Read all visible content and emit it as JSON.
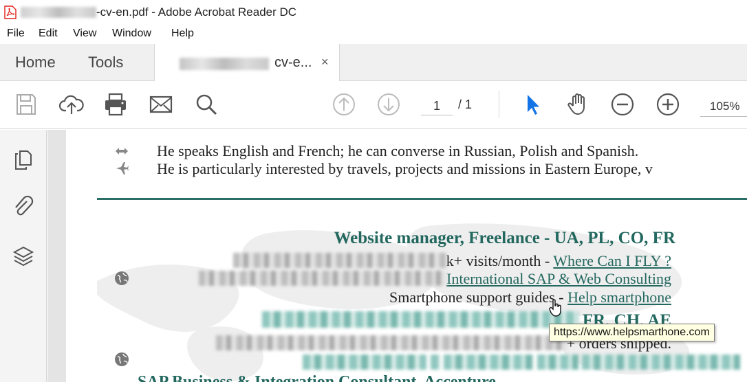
{
  "window": {
    "title": "-cv-en.pdf - Adobe Acrobat Reader DC"
  },
  "menu": {
    "items": [
      "File",
      "Edit",
      "View",
      "Window",
      "Help"
    ]
  },
  "tabs": {
    "home": "Home",
    "tools": "Tools",
    "document": "cv-e...",
    "close": "×"
  },
  "toolbar": {
    "page_current": "1",
    "page_total": "/ 1",
    "zoom": "105%"
  },
  "document": {
    "lines": [
      "He speaks English and French; he can converse in Russian, Polish and Spanish.",
      "He is particularly interested by travels, projects and missions in Eastern Europe, v"
    ],
    "section_heading": "Website manager, Freelance - UA, PL, CO, FR",
    "entry1_prefix": "k+ visits/month - ",
    "entry1_link": "Where Can I FLY ?",
    "entry2_link": "International SAP & Web Consulting",
    "entry3_prefix": "Smartphone support guides - ",
    "entry3_link": "Help smartphone",
    "entry4_suffix": "FR, CH, AE",
    "entry5_suffix": "+ orders shipped.",
    "bottom_heading": "SAP Business & Integration Consultant, Accenture"
  },
  "tooltip": {
    "text": "https://www.helpsmarthone.com"
  },
  "colors": {
    "accent": "#23685f",
    "cursor_blue": "#1473e6",
    "acrobat_red": "#e0201b"
  }
}
